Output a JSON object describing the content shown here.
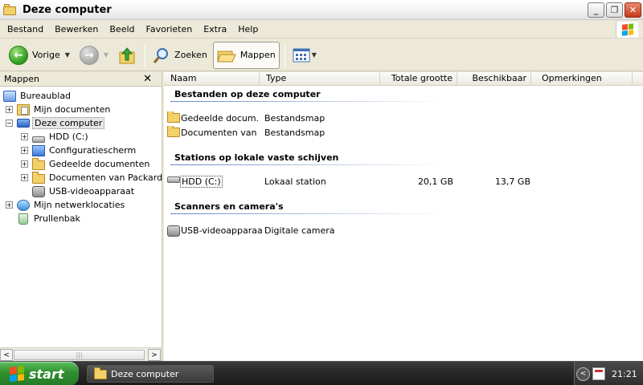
{
  "window": {
    "title": "Deze computer",
    "buttons": {
      "minimize": "_",
      "maximize": "❐",
      "close": "✕"
    }
  },
  "menu": [
    "Bestand",
    "Bewerken",
    "Beeld",
    "Favorieten",
    "Extra",
    "Help"
  ],
  "toolbar": {
    "back_label": "Vorige",
    "search_label": "Zoeken",
    "folders_label": "Mappen"
  },
  "folders_pane": {
    "title": "Mappen",
    "close": "✕",
    "tree": [
      {
        "label": "Bureaublad",
        "expander": "",
        "icon": "desktop-icon"
      },
      {
        "label": "Mijn documenten",
        "expander": "+",
        "icon": "my-documents-icon"
      },
      {
        "label": "Deze computer",
        "expander": "−",
        "icon": "computer-icon"
      },
      {
        "label": "HDD (C:)",
        "expander": "+",
        "icon": "hard-drive-icon"
      },
      {
        "label": "Configuratiescherm",
        "expander": "+",
        "icon": "control-panel-icon"
      },
      {
        "label": "Gedeelde documenten",
        "expander": "+",
        "icon": "folder-icon"
      },
      {
        "label": "Documenten van Packard Bel",
        "expander": "+",
        "icon": "folder-icon"
      },
      {
        "label": "USB-videoapparaat",
        "expander": "",
        "icon": "camera-icon"
      },
      {
        "label": "Mijn netwerklocaties",
        "expander": "+",
        "icon": "network-icon"
      },
      {
        "label": "Prullenbak",
        "expander": "",
        "icon": "recycle-bin-icon"
      }
    ]
  },
  "columns": {
    "name": "Naam",
    "type": "Type",
    "total": "Totale grootte",
    "free": "Beschikbaar",
    "comments": "Opmerkingen"
  },
  "groups": [
    {
      "title": "Bestanden op deze computer",
      "items": [
        {
          "name": "Gedeelde docum...",
          "type": "Bestandsmap",
          "total": "",
          "free": "",
          "icon": "folder-icon"
        },
        {
          "name": "Documenten van ...",
          "type": "Bestandsmap",
          "total": "",
          "free": "",
          "icon": "folder-icon"
        }
      ]
    },
    {
      "title": "Stations op lokale vaste schijven",
      "items": [
        {
          "name": "HDD (C:)",
          "type": "Lokaal station",
          "total": "20,1 GB",
          "free": "13,7 GB",
          "icon": "hard-drive-icon"
        }
      ]
    },
    {
      "title": "Scanners en camera's",
      "items": [
        {
          "name": "USB-videoapparaat",
          "type": "Digitale camera",
          "total": "",
          "free": "",
          "icon": "camera-icon"
        }
      ]
    }
  ],
  "scrollbar": {
    "left": "<",
    "right": ">",
    "grip": "|||"
  },
  "taskbar": {
    "start": "start",
    "task": "Deze computer",
    "tray_arrow": "<",
    "clock": "21:21"
  },
  "colors": {
    "start_green": "#2f8f2f",
    "taskbar": "#2a2a2a",
    "group_line": "#5f86c4"
  }
}
